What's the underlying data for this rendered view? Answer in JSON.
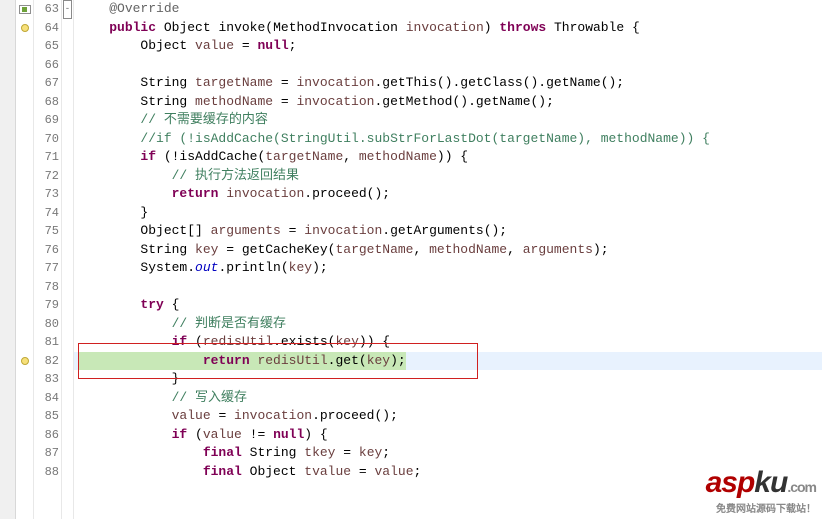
{
  "line_numbers": [
    "63",
    "64",
    "65",
    "66",
    "67",
    "68",
    "69",
    "70",
    "71",
    "72",
    "73",
    "74",
    "75",
    "76",
    "77",
    "78",
    "79",
    "80",
    "81",
    "82",
    "83",
    "84",
    "85",
    "86",
    "87",
    "88"
  ],
  "left_markers": {
    "0": "impl",
    "1": "dot",
    "19": "dot"
  },
  "fold_markers": {
    "0": "minus"
  },
  "code": {
    "l0": {
      "indent": "    ",
      "ann": "@Override"
    },
    "l1": {
      "indent": "    ",
      "kw1": "public",
      "sp1": " ",
      "t1": "Object",
      "sp2": " ",
      "m": "invoke",
      "p1": "(",
      "t2": "MethodInvocation",
      "sp3": " ",
      "pr": "invocation",
      "p2": ") ",
      "kw2": "throws",
      "sp4": " ",
      "t3": "Throwable",
      "p3": " {"
    },
    "l2": {
      "indent": "        ",
      "t": "Object ",
      "v": "value",
      "eq": " = ",
      "kw": "null",
      "sc": ";"
    },
    "l3": {
      "indent": ""
    },
    "l4": {
      "indent": "        ",
      "t": "String ",
      "v": "targetName",
      "eq": " = ",
      "pr": "invocation",
      "c": ".getThis().getClass().getName();"
    },
    "l5": {
      "indent": "        ",
      "t": "String ",
      "v": "methodName",
      "eq": " = ",
      "pr": "invocation",
      "c": ".getMethod().getName();"
    },
    "l6": {
      "indent": "        ",
      "com": "// 不需要缓存的内容"
    },
    "l7": {
      "indent": "        ",
      "com": "//if (!isAddCache(StringUtil.subStrForLastDot(targetName), methodName)) {"
    },
    "l8": {
      "indent": "        ",
      "kw": "if",
      "p": " (!isAddCache(",
      "v1": "targetName",
      "c1": ", ",
      "v2": "methodName",
      "p2": ")) {"
    },
    "l9": {
      "indent": "            ",
      "com": "// 执行方法返回结果"
    },
    "l10": {
      "indent": "            ",
      "kw": "return",
      "sp": " ",
      "pr": "invocation",
      "c": ".proceed();"
    },
    "l11": {
      "indent": "        ",
      "p": "}"
    },
    "l12": {
      "indent": "        ",
      "t": "Object[] ",
      "v": "arguments",
      "eq": " = ",
      "pr": "invocation",
      "c": ".getArguments();"
    },
    "l13": {
      "indent": "        ",
      "t": "String ",
      "v": "key",
      "eq": " = getCacheKey(",
      "v1": "targetName",
      "c1": ", ",
      "v2": "methodName",
      "c2": ", ",
      "v3": "arguments",
      "p2": ");"
    },
    "l14": {
      "indent": "        ",
      "t": "System.",
      "sf": "out",
      "c": ".println(",
      "v": "key",
      "p2": ");"
    },
    "l15": {
      "indent": ""
    },
    "l16": {
      "indent": "        ",
      "kw": "try",
      "p": " {"
    },
    "l17": {
      "indent": "            ",
      "com": "// 判断是否有缓存"
    },
    "l18": {
      "indent": "            ",
      "kw": "if",
      "p": " (",
      "f": "redisUtil",
      "c": ".exists(",
      "v": "key",
      "p2": ")) {"
    },
    "l19": {
      "indent": "                ",
      "kw": "return",
      "sp": " ",
      "f": "redisUtil",
      "c": ".get(",
      "v": "key",
      "p2": ");"
    },
    "l20": {
      "indent": "            ",
      "p": "}"
    },
    "l21": {
      "indent": "            ",
      "com": "// 写入缓存"
    },
    "l22": {
      "indent": "            ",
      "v": "value",
      "eq": " = ",
      "pr": "invocation",
      "c": ".proceed();"
    },
    "l23": {
      "indent": "            ",
      "kw": "if",
      "p": " (",
      "v": "value",
      "c": " != ",
      "kw2": "null",
      "p2": ") {"
    },
    "l24": {
      "indent": "                ",
      "kw": "final",
      "sp": " ",
      "t": "String ",
      "v": "tkey",
      "eq": " = ",
      "v2": "key",
      "sc": ";"
    },
    "l25": {
      "indent": "                ",
      "kw": "final",
      "sp": " ",
      "t": "Object ",
      "v": "tvalue",
      "eq": " = ",
      "v2": "value",
      "sc": ";"
    }
  },
  "highlight_current": 19,
  "red_box_line": 19,
  "watermark": {
    "brand1": "asp",
    "brand2": "ku",
    "dom": ".com",
    "sub": "免费网站源码下载站！"
  }
}
